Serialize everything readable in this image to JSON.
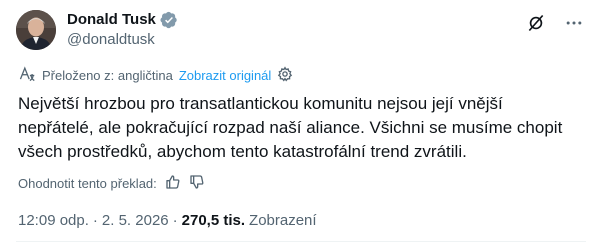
{
  "author": {
    "name": "Donald Tusk",
    "handle": "@donaldtusk",
    "verified_icon": "verified-badge-icon",
    "verified_color": "#829aab"
  },
  "top_actions": {
    "grok_icon": "grok-icon",
    "more_icon": "more-icon"
  },
  "translation": {
    "notice": "Přeloženo z: angličtina",
    "show_original": "Zobrazit originál",
    "translate_icon": "translate-icon",
    "settings_icon": "gear-icon",
    "link_color": "#1d9bf0"
  },
  "tweet": {
    "text": "Největší hrozbou pro transatlantickou komunitu nejsou její vnější nepřátelé, ale pokračující rozpad naší aliance. Všichni se musíme chopit všech prostředků, abychom tento katastrofální trend zvrátili."
  },
  "rate": {
    "label": "Ohodnotit tento překlad:",
    "thumbs_up_icon": "thumbs-up-icon",
    "thumbs_down_icon": "thumbs-down-icon"
  },
  "meta": {
    "time": "12:09 odp.",
    "separator1": "·",
    "date": "2. 5. 2026",
    "separator2": "·",
    "views_count": "270,5 tis.",
    "views_label": "Zobrazení"
  }
}
